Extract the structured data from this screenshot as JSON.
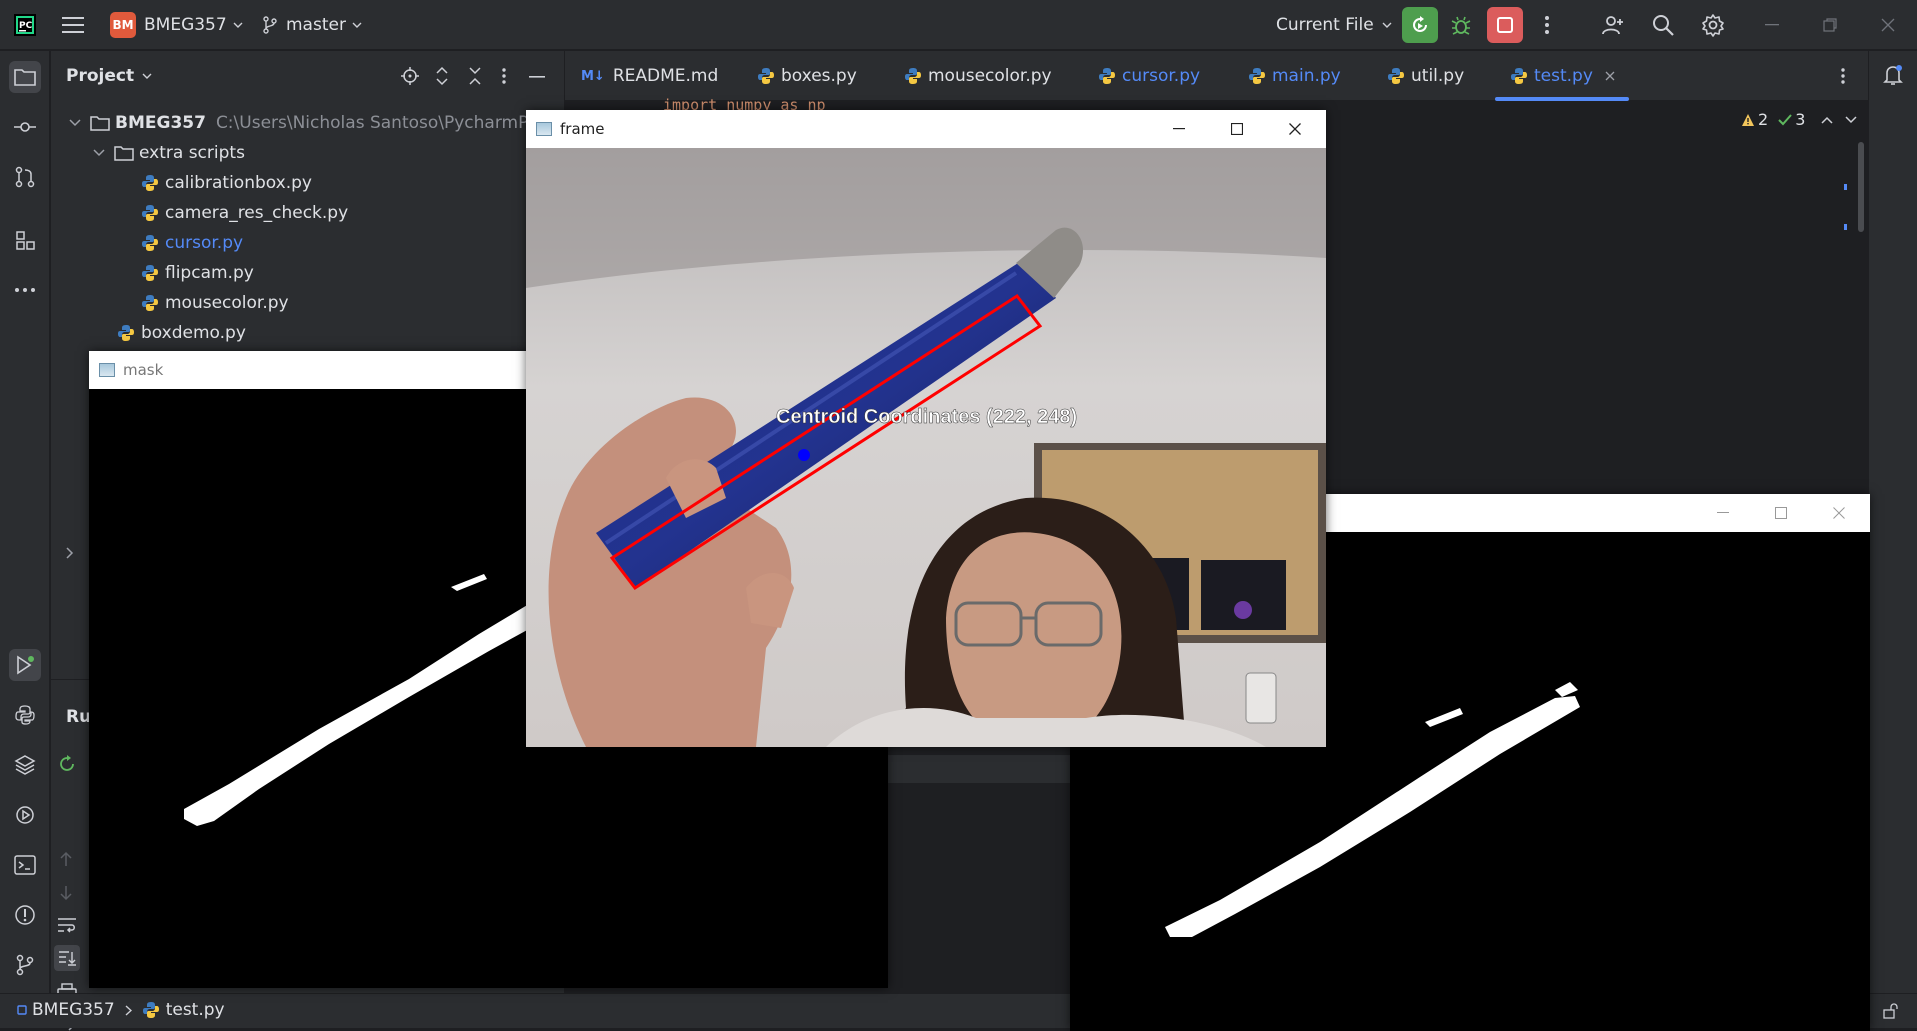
{
  "titlebar": {
    "project_badge": "BM",
    "project_name": "BMEG357",
    "branch": "master",
    "run_config": "Current File"
  },
  "project_panel": {
    "title": "Project",
    "root_name": "BMEG357",
    "root_path": "C:\\Users\\Nicholas Santoso\\PycharmProje",
    "folder_extra": "extra scripts",
    "files": [
      "calibrationbox.py",
      "camera_res_check.py",
      "cursor.py",
      "flipcam.py",
      "mousecolor.py"
    ],
    "file_boxdemo": "boxdemo.py",
    "run_label": "Ru"
  },
  "tabs": [
    {
      "prefix": "M↓",
      "label": "README.md"
    },
    {
      "label": "boxes.py"
    },
    {
      "label": "mousecolor.py"
    },
    {
      "label": "cursor.py"
    },
    {
      "label": "main.py"
    },
    {
      "label": "util.py"
    },
    {
      "label": "test.py"
    }
  ],
  "editor": {
    "code_peek": "import numpy as np",
    "warnings_count": "2",
    "checks_count": "3"
  },
  "windows": {
    "mask_title": "mask",
    "frame_title": "frame",
    "overlay_text": "Centroid Coordinates (222, 248)"
  },
  "statusbar": {
    "project": "BMEG357",
    "file": "test.py"
  },
  "colors": {
    "accent": "#548af7",
    "run_green": "#4e9e4e",
    "stop_red": "#db5c5c",
    "bbox_red": "#ff0000",
    "centroid_blue": "#0000ff"
  }
}
